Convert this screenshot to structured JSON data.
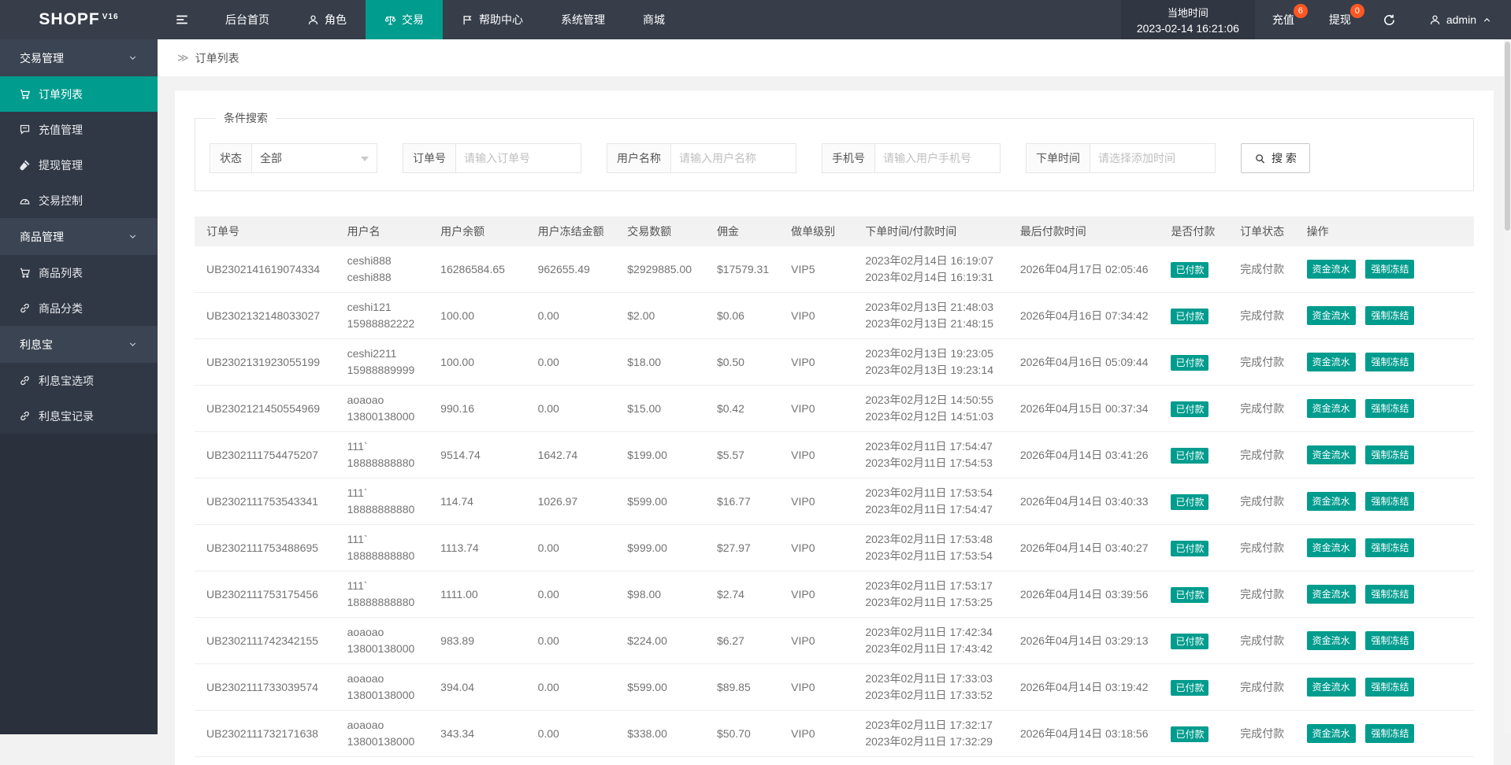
{
  "colors": {
    "accent": "#009c8e",
    "badge_orange": "#ff5722",
    "nav_bg": "#373e4a",
    "sidebar_bg": "#313845"
  },
  "brand": {
    "name": "SHOPF",
    "version": "V16"
  },
  "topnav": {
    "items": [
      {
        "label": "后台首页"
      },
      {
        "label": "角色"
      },
      {
        "label": "交易"
      },
      {
        "label": "帮助中心"
      },
      {
        "label": "系统管理"
      },
      {
        "label": "商城"
      }
    ]
  },
  "header_right": {
    "local_time_label": "当地时间",
    "local_time": "2023-02-14 16:21:06",
    "recharge_label": "充值",
    "recharge_count": "6",
    "withdraw_label": "提现",
    "withdraw_count": "0",
    "username": "admin"
  },
  "sidebar": {
    "groups": [
      {
        "label": "交易管理",
        "items": [
          {
            "label": "订单列表"
          },
          {
            "label": "充值管理"
          },
          {
            "label": "提现管理"
          },
          {
            "label": "交易控制"
          }
        ]
      },
      {
        "label": "商品管理",
        "items": [
          {
            "label": "商品列表"
          },
          {
            "label": "商品分类"
          }
        ]
      },
      {
        "label": "利息宝",
        "items": [
          {
            "label": "利息宝选项"
          },
          {
            "label": "利息宝记录"
          }
        ]
      }
    ]
  },
  "breadcrumb": {
    "icon": "≫",
    "label": "订单列表"
  },
  "filters": {
    "legend": "条件搜索",
    "status_label": "状态",
    "status_value": "全部",
    "order_label": "订单号",
    "order_placeholder": "请输入订单号",
    "user_label": "用户名称",
    "user_placeholder": "请输入用户名称",
    "phone_label": "手机号",
    "phone_placeholder": "请输入用户手机号",
    "time_label": "下单时间",
    "time_placeholder": "请选择添加时间",
    "search_label": "搜 索"
  },
  "table": {
    "headers": [
      "订单号",
      "用户名",
      "用户余额",
      "用户冻结金额",
      "交易数额",
      "佣金",
      "做单级别",
      "下单时间/付款时间",
      "最后付款时间",
      "是否付款",
      "订单状态",
      "操作"
    ],
    "rows": [
      {
        "no": "UB2302141619074334",
        "user1": "ceshi888",
        "user2": "ceshi888",
        "balance": "16286584.65",
        "frozen": "962655.49",
        "amount": "$2929885.00",
        "commission": "$17579.31",
        "level": "VIP5",
        "t1": "2023年02月14日 16:19:07",
        "t2": "2023年02月14日 16:19:31",
        "last": "2026年04月17日 02:05:46",
        "paid": "已付款",
        "status": "完成付款",
        "act1": "资金流水",
        "act2": "强制冻结"
      },
      {
        "no": "UB2302132148033027",
        "user1": "ceshi121",
        "user2": "15988882222",
        "balance": "100.00",
        "frozen": "0.00",
        "amount": "$2.00",
        "commission": "$0.06",
        "level": "VIP0",
        "t1": "2023年02月13日 21:48:03",
        "t2": "2023年02月13日 21:48:15",
        "last": "2026年04月16日 07:34:42",
        "paid": "已付款",
        "status": "完成付款",
        "act1": "资金流水",
        "act2": "强制冻结"
      },
      {
        "no": "UB2302131923055199",
        "user1": "ceshi2211",
        "user2": "15988889999",
        "balance": "100.00",
        "frozen": "0.00",
        "amount": "$18.00",
        "commission": "$0.50",
        "level": "VIP0",
        "t1": "2023年02月13日 19:23:05",
        "t2": "2023年02月13日 19:23:14",
        "last": "2026年04月16日 05:09:44",
        "paid": "已付款",
        "status": "完成付款",
        "act1": "资金流水",
        "act2": "强制冻结"
      },
      {
        "no": "UB2302121450554969",
        "user1": "aoaoao",
        "user2": "13800138000",
        "balance": "990.16",
        "frozen": "0.00",
        "amount": "$15.00",
        "commission": "$0.42",
        "level": "VIP0",
        "t1": "2023年02月12日 14:50:55",
        "t2": "2023年02月12日 14:51:03",
        "last": "2026年04月15日 00:37:34",
        "paid": "已付款",
        "status": "完成付款",
        "act1": "资金流水",
        "act2": "强制冻结"
      },
      {
        "no": "UB2302111754475207",
        "user1": "111`",
        "user2": "18888888880",
        "balance": "9514.74",
        "frozen": "1642.74",
        "amount": "$199.00",
        "commission": "$5.57",
        "level": "VIP0",
        "t1": "2023年02月11日 17:54:47",
        "t2": "2023年02月11日 17:54:53",
        "last": "2026年04月14日 03:41:26",
        "paid": "已付款",
        "status": "完成付款",
        "act1": "资金流水",
        "act2": "强制冻结"
      },
      {
        "no": "UB2302111753543341",
        "user1": "111`",
        "user2": "18888888880",
        "balance": "114.74",
        "frozen": "1026.97",
        "amount": "$599.00",
        "commission": "$16.77",
        "level": "VIP0",
        "t1": "2023年02月11日 17:53:54",
        "t2": "2023年02月11日 17:54:47",
        "last": "2026年04月14日 03:40:33",
        "paid": "已付款",
        "status": "完成付款",
        "act1": "资金流水",
        "act2": "强制冻结"
      },
      {
        "no": "UB2302111753488695",
        "user1": "111`",
        "user2": "18888888880",
        "balance": "1113.74",
        "frozen": "0.00",
        "amount": "$999.00",
        "commission": "$27.97",
        "level": "VIP0",
        "t1": "2023年02月11日 17:53:48",
        "t2": "2023年02月11日 17:53:54",
        "last": "2026年04月14日 03:40:27",
        "paid": "已付款",
        "status": "完成付款",
        "act1": "资金流水",
        "act2": "强制冻结"
      },
      {
        "no": "UB2302111753175456",
        "user1": "111`",
        "user2": "18888888880",
        "balance": "1111.00",
        "frozen": "0.00",
        "amount": "$98.00",
        "commission": "$2.74",
        "level": "VIP0",
        "t1": "2023年02月11日 17:53:17",
        "t2": "2023年02月11日 17:53:25",
        "last": "2026年04月14日 03:39:56",
        "paid": "已付款",
        "status": "完成付款",
        "act1": "资金流水",
        "act2": "强制冻结"
      },
      {
        "no": "UB2302111742342155",
        "user1": "aoaoao",
        "user2": "13800138000",
        "balance": "983.89",
        "frozen": "0.00",
        "amount": "$224.00",
        "commission": "$6.27",
        "level": "VIP0",
        "t1": "2023年02月11日 17:42:34",
        "t2": "2023年02月11日 17:43:42",
        "last": "2026年04月14日 03:29:13",
        "paid": "已付款",
        "status": "完成付款",
        "act1": "资金流水",
        "act2": "强制冻结"
      },
      {
        "no": "UB2302111733039574",
        "user1": "aoaoao",
        "user2": "13800138000",
        "balance": "394.04",
        "frozen": "0.00",
        "amount": "$599.00",
        "commission": "$89.85",
        "level": "VIP0",
        "t1": "2023年02月11日 17:33:03",
        "t2": "2023年02月11日 17:33:52",
        "last": "2026年04月14日 03:19:42",
        "paid": "已付款",
        "status": "完成付款",
        "act1": "资金流水",
        "act2": "强制冻结"
      },
      {
        "no": "UB2302111732171638",
        "user1": "aoaoao",
        "user2": "13800138000",
        "balance": "343.34",
        "frozen": "0.00",
        "amount": "$338.00",
        "commission": "$50.70",
        "level": "VIP0",
        "t1": "2023年02月11日 17:32:17",
        "t2": "2023年02月11日 17:32:29",
        "last": "2026年04月14日 03:18:56",
        "paid": "已付款",
        "status": "完成付款",
        "act1": "资金流水",
        "act2": "强制冻结"
      }
    ]
  }
}
